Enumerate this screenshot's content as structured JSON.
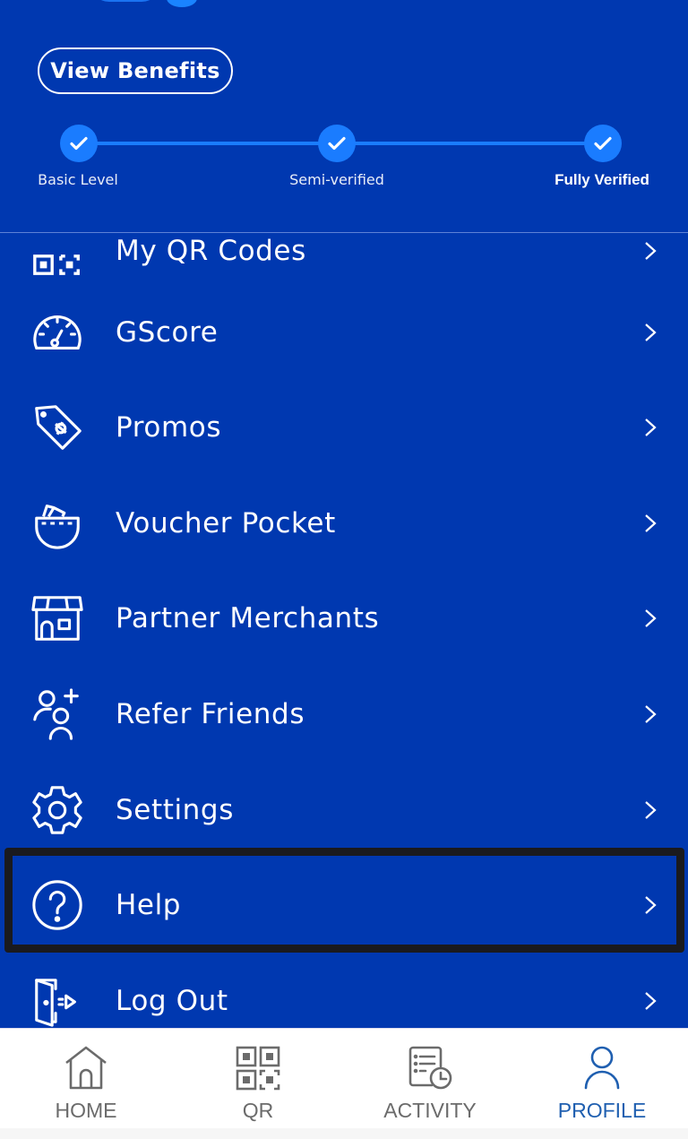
{
  "colors": {
    "background": "#0038b0",
    "accent": "#1a7cff",
    "nav_active": "#1f5fb0",
    "nav_inactive": "#6b6b6b",
    "highlight_border": "#1a1a1e"
  },
  "header": {
    "view_benefits_label": "View Benefits",
    "verification_steps": [
      {
        "label": "Basic Level",
        "completed": true,
        "current": false
      },
      {
        "label": "Semi-verified",
        "completed": true,
        "current": false
      },
      {
        "label": "Fully Verified",
        "completed": true,
        "current": true
      }
    ]
  },
  "menu": {
    "items": [
      {
        "label": "My QR Codes",
        "icon": "qr-code-icon",
        "partially_hidden": true
      },
      {
        "label": "GScore",
        "icon": "speedometer-icon"
      },
      {
        "label": "Promos",
        "icon": "tag-icon"
      },
      {
        "label": "Voucher Pocket",
        "icon": "voucher-pocket-icon"
      },
      {
        "label": "Partner Merchants",
        "icon": "store-icon"
      },
      {
        "label": "Refer Friends",
        "icon": "add-user-icon"
      },
      {
        "label": "Settings",
        "icon": "gear-icon"
      },
      {
        "label": "Help",
        "icon": "help-icon",
        "highlighted": true
      },
      {
        "label": "Log Out",
        "icon": "logout-icon"
      }
    ]
  },
  "bottom_nav": {
    "tabs": [
      {
        "label": "HOME",
        "icon": "home-icon",
        "active": false
      },
      {
        "label": "QR",
        "icon": "qr-icon",
        "active": false
      },
      {
        "label": "ACTIVITY",
        "icon": "activity-icon",
        "active": false
      },
      {
        "label": "PROFILE",
        "icon": "profile-icon",
        "active": true
      }
    ]
  }
}
